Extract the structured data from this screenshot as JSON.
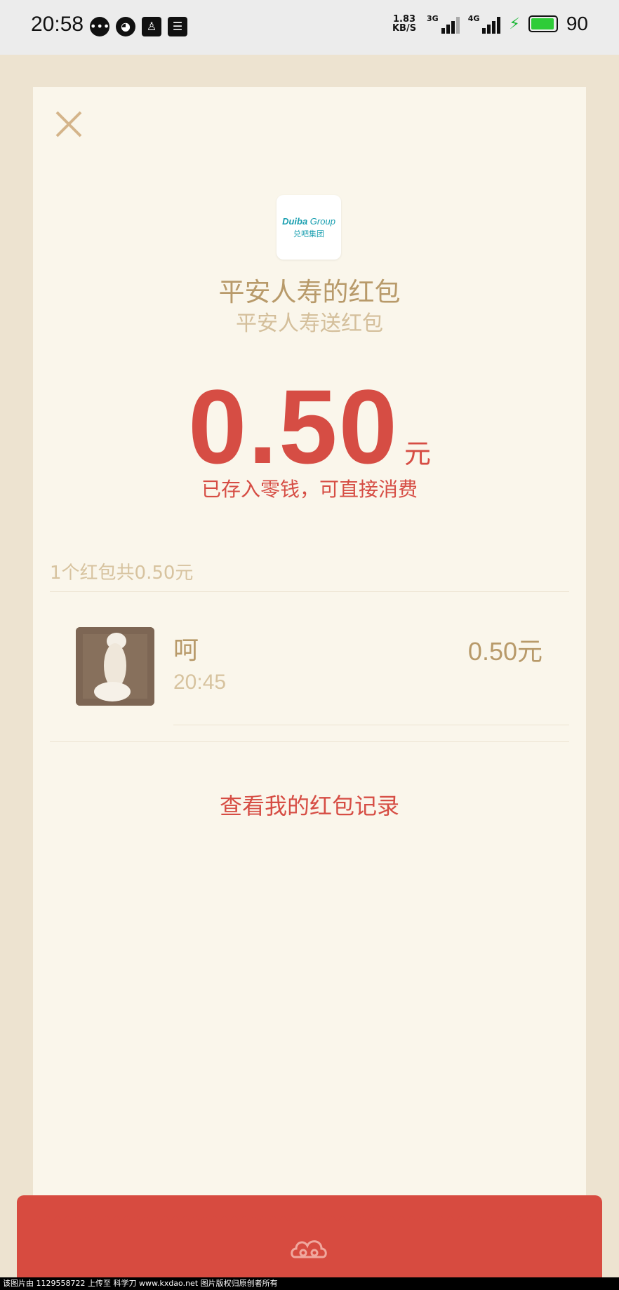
{
  "status_bar": {
    "time": "20:58",
    "speed_top": "1.83",
    "speed_bottom": "KB/S",
    "net1": "3G",
    "net2": "4G",
    "battery": "90"
  },
  "envelope": {
    "logo_text_bold": "Duiba",
    "logo_text": " Group",
    "logo_sub": "兑吧集团",
    "title": "平安人寿的红包",
    "subtitle": "平安人寿送红包",
    "amount": "0.50",
    "unit": "元",
    "note": "已存入零钱，可直接消费"
  },
  "summary": "1个红包共0.50元",
  "records": [
    {
      "name": "呵",
      "time": "20:45",
      "amount": "0.50元"
    }
  ],
  "link": "查看我的红包记录",
  "watermark": "该图片由 1129558722 上传至 科学刀 www.kxdao.net 图片版权归原创者所有",
  "colors": {
    "accent_red": "#d64d44",
    "gold": "#b89a6a",
    "card_bg": "#faf6eb",
    "page_bg": "#ede3d0"
  }
}
